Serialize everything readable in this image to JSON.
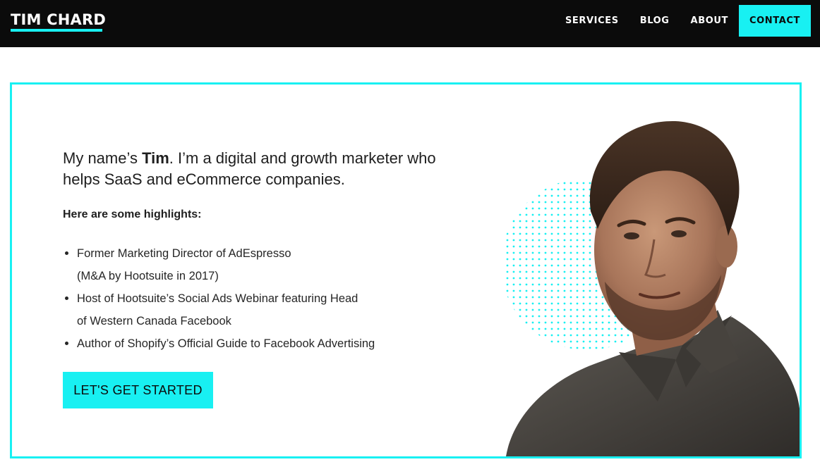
{
  "header": {
    "logo": "TIM CHARD",
    "nav": [
      {
        "label": "SERVICES"
      },
      {
        "label": "BLOG"
      },
      {
        "label": "ABOUT"
      },
      {
        "label": "CONTACT"
      }
    ]
  },
  "hero": {
    "intro_prefix": "My name’s ",
    "intro_name": "Tim",
    "intro_rest": ". I’m a digital and growth marketer who helps SaaS and eCommerce companies.",
    "highlights_heading": "Here are some highlights:",
    "highlights": [
      {
        "line1": "Former Marketing Director of AdEspresso",
        "line2": "(M&A by Hootsuite in 2017)"
      },
      {
        "line1": "Host of Hootsuite’s Social Ads Webinar featuring Head",
        "line2": "of Western Canada Facebook"
      },
      {
        "line1": "Author of Shopify’s Official Guide to Facebook Advertising",
        "line2": ""
      }
    ],
    "cta_label": "LET'S GET STARTED"
  },
  "colors": {
    "accent": "#18f0f2",
    "header_bg": "#0b0b0b",
    "text": "#1e1e1e"
  }
}
